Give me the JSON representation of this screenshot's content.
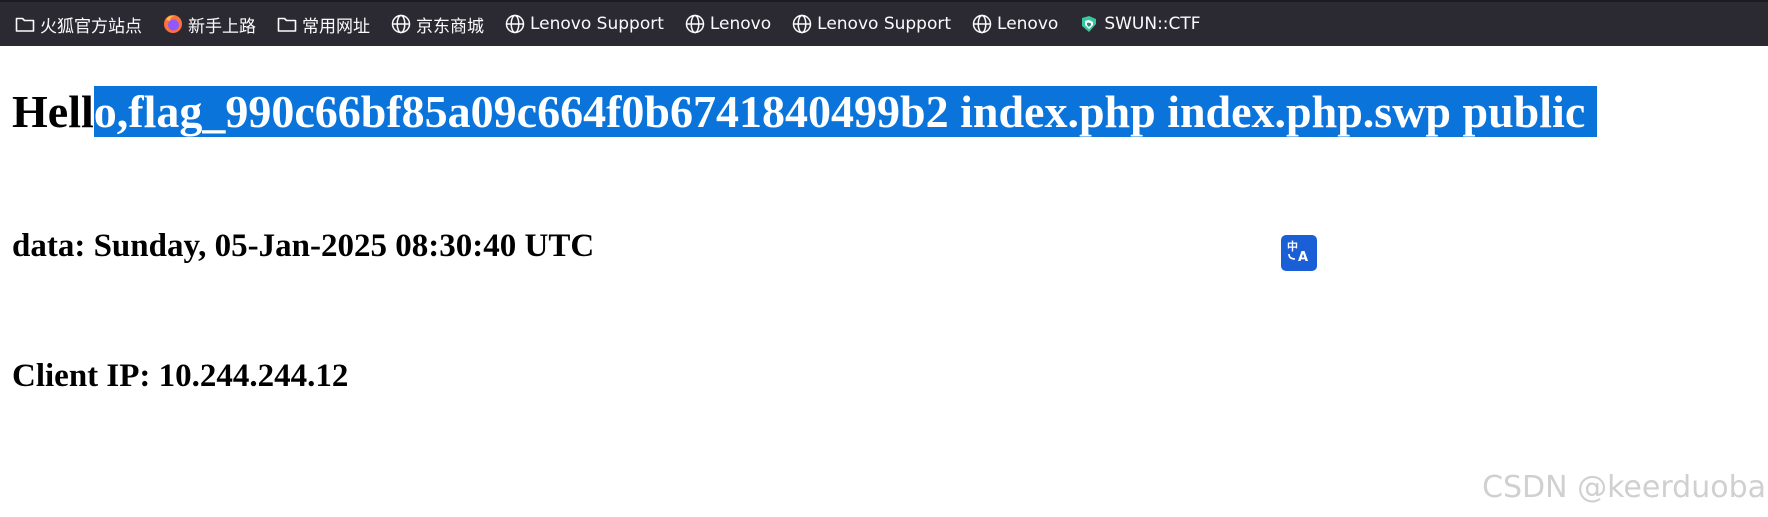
{
  "bookmarks": [
    {
      "label": "火狐官方站点",
      "icon": "folder-icon"
    },
    {
      "label": "新手上路",
      "icon": "firefox-icon"
    },
    {
      "label": "常用网址",
      "icon": "folder-icon"
    },
    {
      "label": "京东商城",
      "icon": "globe-icon"
    },
    {
      "label": "Lenovo Support",
      "icon": "globe-icon"
    },
    {
      "label": "Lenovo",
      "icon": "globe-icon"
    },
    {
      "label": "Lenovo Support",
      "icon": "globe-icon"
    },
    {
      "label": "Lenovo",
      "icon": "globe-icon"
    },
    {
      "label": "SWUN::CTF",
      "icon": "swun-ctf-icon"
    }
  ],
  "page": {
    "heading_unselected": "Hell",
    "heading_selected": "o,flag_990c66bf85a09c664f0b6741840499b2 index.php index.php.swp public",
    "date_text": "data: Sunday, 05-Jan-2025 08:30:40 UTC",
    "client_ip_text": "Client IP: 10.244.244.12"
  },
  "translate_button": {
    "icon": "translate-icon",
    "color": "#1a5fd6"
  },
  "watermark": "CSDN @keerduoba",
  "colors": {
    "toolbar_bg": "#2b2a33",
    "selection_bg": "#0a74db",
    "selection_text": "#ffffff"
  }
}
